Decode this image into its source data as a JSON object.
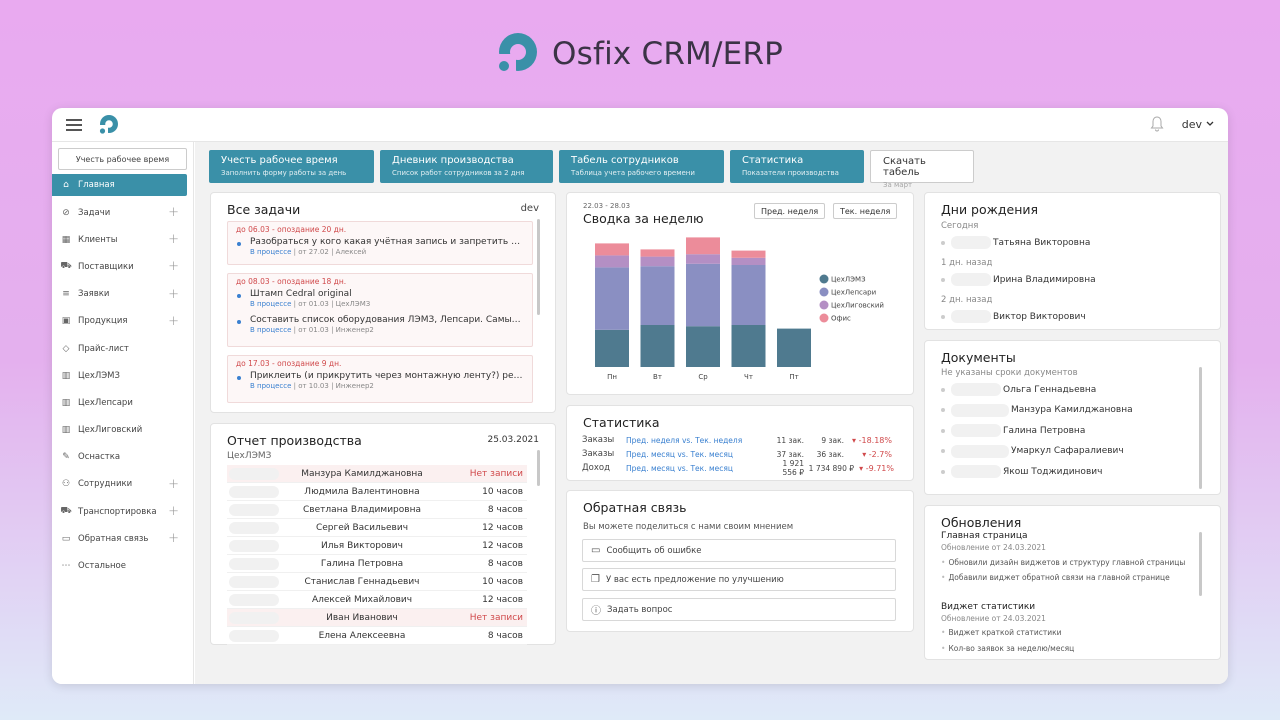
{
  "brand": {
    "title": "Osfix CRM/ERP"
  },
  "topbar": {
    "user": "dev"
  },
  "sidebar": {
    "track_button": "Учесть рабочее время",
    "items": [
      {
        "label": "Главная",
        "icon": "home-icon",
        "active": true,
        "plus": false
      },
      {
        "label": "Задачи",
        "icon": "check-circle-icon",
        "plus": true
      },
      {
        "label": "Клиенты",
        "icon": "building-icon",
        "plus": true
      },
      {
        "label": "Поставщики",
        "icon": "truck-icon",
        "plus": true
      },
      {
        "label": "Заявки",
        "icon": "list-icon",
        "plus": true
      },
      {
        "label": "Продукция",
        "icon": "box-icon",
        "plus": true
      },
      {
        "label": "Прайс-лист",
        "icon": "tag-icon",
        "plus": false
      },
      {
        "label": "ЦехЛЭМЗ",
        "icon": "factory-icon",
        "plus": false
      },
      {
        "label": "ЦехЛепсари",
        "icon": "factory-icon",
        "plus": false
      },
      {
        "label": "ЦехЛиговский",
        "icon": "factory-icon",
        "plus": false
      },
      {
        "label": "Оснастка",
        "icon": "wrench-icon",
        "plus": false
      },
      {
        "label": "Сотрудники",
        "icon": "users-icon",
        "plus": true
      },
      {
        "label": "Транспортировка",
        "icon": "truck-icon",
        "plus": true
      },
      {
        "label": "Обратная связь",
        "icon": "chat-icon",
        "plus": true
      },
      {
        "label": "Остальное",
        "icon": "dots-icon",
        "plus": false
      }
    ]
  },
  "quick_actions": [
    {
      "title": "Учесть рабочее время",
      "sub": "Заполнить форму работы за день"
    },
    {
      "title": "Дневник производства",
      "sub": "Список работ сотрудников за 2 дня"
    },
    {
      "title": "Табель сотрудников",
      "sub": "Таблица учета рабочего времени"
    },
    {
      "title": "Статистика",
      "sub": "Показатели производства"
    },
    {
      "title": "Скачать табель",
      "sub": "За март"
    }
  ],
  "tasks": {
    "title": "Все задачи",
    "user": "dev",
    "groups": [
      {
        "header": "до 06.03 - опоздание 20 дн.",
        "items": [
          {
            "text": "Разобраться у кого какая учётная запись и запретить пол...",
            "status": "В процессе",
            "from": "от 27.02",
            "who": "Алексей"
          }
        ]
      },
      {
        "header": "до 08.03 - опоздание 18 дн.",
        "items": [
          {
            "text": "Штамп Cedral original",
            "status": "В процессе",
            "from": "от 01.03",
            "who": "ЦехЛЭМЗ"
          },
          {
            "text": "Составить список оборудования ЛЭМЗ, Лепсари. Самый ...",
            "status": "В процессе",
            "from": "от 01.03",
            "who": "Инженер2"
          }
        ]
      },
      {
        "header": "до 17.03 - опоздание 9 дн.",
        "items": [
          {
            "text": "Приклеить (и прикрутить через монтажную ленту?) рези...",
            "status": "В процессе",
            "from": "от 10.03",
            "who": "Инженер2"
          }
        ]
      }
    ]
  },
  "report": {
    "title": "Отчет производства",
    "date": "25.03.2021",
    "workshop": "ЦехЛЭМЗ",
    "rows": [
      {
        "name": "Манзура Камилджановна",
        "hours": "Нет записи",
        "warn": true
      },
      {
        "name": "Людмила Валентиновна",
        "hours": "10 часов"
      },
      {
        "name": "Светлана Владимировна",
        "hours": "8 часов"
      },
      {
        "name": "Сергей Васильевич",
        "hours": "12 часов"
      },
      {
        "name": "Илья Викторович",
        "hours": "12 часов"
      },
      {
        "name": "Галина Петровна",
        "hours": "8 часов"
      },
      {
        "name": "Станислав Геннадьевич",
        "hours": "10 часов"
      },
      {
        "name": "Алексей Михайлович",
        "hours": "12 часов"
      },
      {
        "name": "Иван Иванович",
        "hours": "Нет записи",
        "warn": true
      },
      {
        "name": "Елена Алексеевна",
        "hours": "8 часов"
      }
    ]
  },
  "weekly": {
    "range": "22.03 - 28.03",
    "title": "Сводка за неделю",
    "prev_btn": "Пред. неделя",
    "cur_btn": "Тек. неделя"
  },
  "chart_data": {
    "type": "bar",
    "stacked": true,
    "categories": [
      "Пн",
      "Вт",
      "Ср",
      "Чт",
      "Пт"
    ],
    "series": [
      {
        "name": "ЦехЛЭМЗ",
        "color": "#4f7a8f",
        "values": [
          31,
          35,
          34,
          35,
          32
        ]
      },
      {
        "name": "ЦехЛепсари",
        "color": "#8a8fc2",
        "values": [
          52,
          49,
          52,
          50,
          0
        ]
      },
      {
        "name": "ЦехЛиговский",
        "color": "#b48fc4",
        "values": [
          10,
          8,
          8,
          6,
          0
        ]
      },
      {
        "name": "Офис",
        "color": "#ec8c9a",
        "values": [
          10,
          6,
          14,
          6,
          0
        ]
      }
    ]
  },
  "stats": {
    "title": "Статистика",
    "rows": [
      {
        "label": "Заказы",
        "period": "Пред. неделя vs. Тек. неделя",
        "v1": "11 зак.",
        "v2": "9 зак.",
        "change": "-18.18%"
      },
      {
        "label": "Заказы",
        "period": "Пред. месяц vs. Тек. месяц",
        "v1": "37 зак.",
        "v2": "36 зак.",
        "change": "-2.7%"
      },
      {
        "label": "Доход",
        "period": "Пред. месяц vs. Тек. месяц",
        "v1": "1 921 556 ₽",
        "v2": "1 734 890 ₽",
        "change": "-9.71%"
      }
    ]
  },
  "feedback": {
    "title": "Обратная связь",
    "sub": "Вы можете поделиться с нами своим мнением",
    "buttons": [
      "Сообщить об ошибке",
      "У вас есть предложение по улучшению",
      "Задать вопрос"
    ]
  },
  "birthdays": {
    "title": "Дни рождения",
    "groups": [
      {
        "label": "Сегодня",
        "name": "Татьяна Викторовна"
      },
      {
        "label": "1 дн. назад",
        "name": "Ирина Владимировна"
      },
      {
        "label": "2 дн. назад",
        "name": "Виктор Викторович"
      }
    ]
  },
  "documents": {
    "title": "Документы",
    "sub": "Не указаны сроки документов",
    "names": [
      "Ольга Геннадьевна",
      "Манзура Камилджановна",
      "Галина Петровна",
      "Умаркул Сафаралиевич",
      "Якош Тоджидинович"
    ]
  },
  "updates": {
    "title": "Обновления",
    "blocks": [
      {
        "title": "Главная страница",
        "date": "Обновление от 24.03.2021",
        "items": [
          "Обновили дизайн виджетов и структуру главной страницы",
          "Добавили виджет обратной связи на главной странице"
        ]
      },
      {
        "title": "Виджет статистики",
        "date": "Обновление от 24.03.2021",
        "items": [
          "Виджет краткой статистики",
          "Кол-во заявок за неделю/месяц"
        ]
      }
    ]
  }
}
